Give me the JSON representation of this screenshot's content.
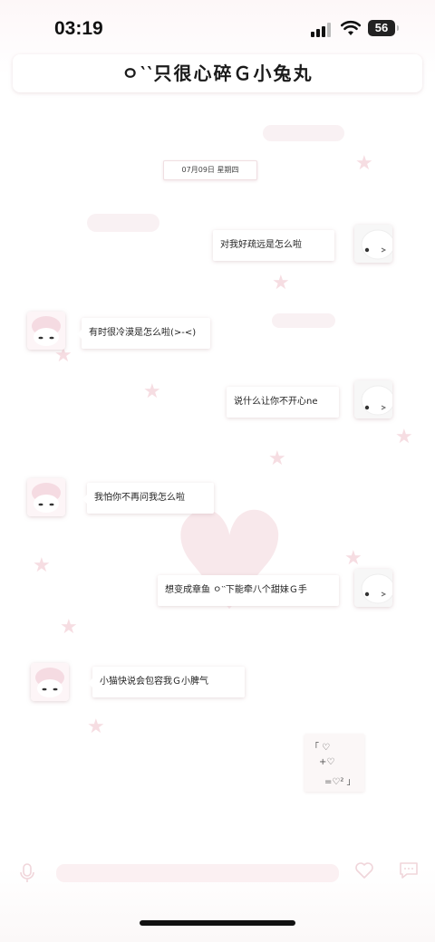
{
  "status_bar": {
    "time": "03:19",
    "battery": "56"
  },
  "header": {
    "title": "ㅇ‵‵只很心碎Ｇ小兔丸"
  },
  "date_label": "07月09日  星期四",
  "messages": [
    {
      "side": "right",
      "text": "对我好疏远是怎么啦"
    },
    {
      "side": "left",
      "text": "有时很冷漠是怎么啦(>-<)"
    },
    {
      "side": "right",
      "text": "说什么让你不开心ne"
    },
    {
      "side": "left",
      "text": "我怕你不再问我怎么啦"
    },
    {
      "side": "right",
      "text": "想变成章鱼 ㅇ‵‵下能牵八个甜妹Ｇ手"
    },
    {
      "side": "left",
      "text": "小猫快说会包容我Ｇ小脾气"
    }
  ],
  "note_card": {
    "line1": "「 ♡",
    "line2": "+♡",
    "line3": "=♡² 」"
  },
  "colors": {
    "accent_pink": "#f3d7dc",
    "bubble_bg": "#ffffff",
    "input_bg": "#fbf0f2"
  },
  "icons": {
    "mic": "mic-icon",
    "heart": "heart-icon",
    "chat": "chat-icon"
  }
}
